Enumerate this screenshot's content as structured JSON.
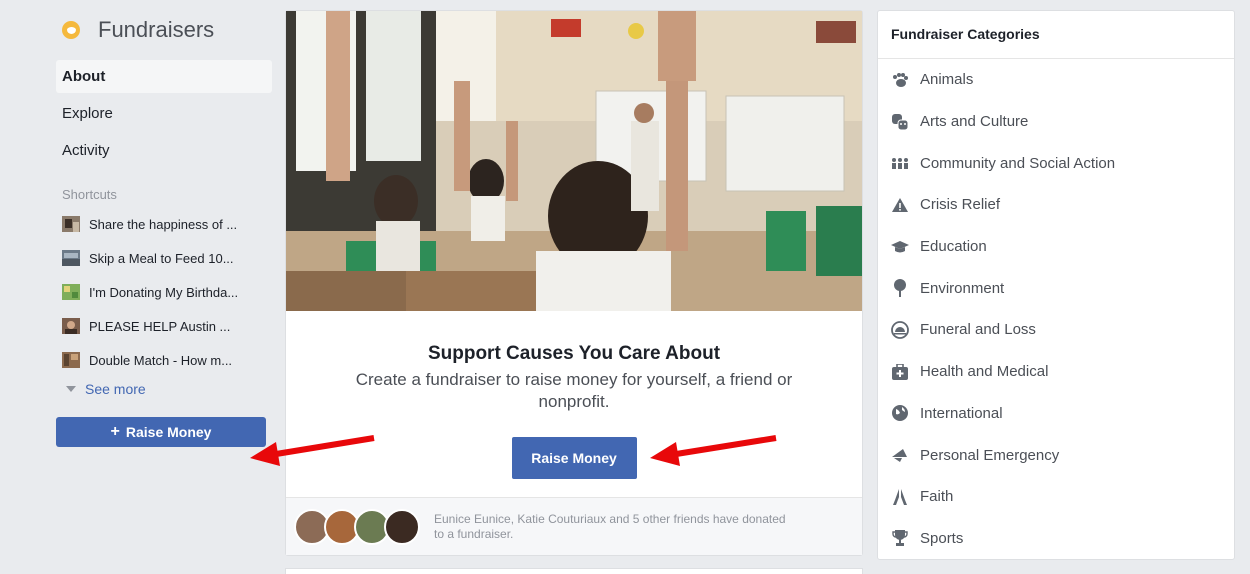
{
  "sidebar": {
    "title": "Fundraisers",
    "nav": [
      "About",
      "Explore",
      "Activity"
    ],
    "shortcuts_label": "Shortcuts",
    "shortcuts": [
      "Share the happiness of ...",
      "Skip a Meal to Feed 10...",
      "I'm Donating My Birthda...",
      "PLEASE HELP Austin ...",
      "Double Match - How m..."
    ],
    "see_more": "See more",
    "raise_button": "Raise Money"
  },
  "promo": {
    "title": "Support Causes You Care About",
    "subtitle": "Create a fundraiser to raise money for yourself, a friend or nonprofit.",
    "button": "Raise Money"
  },
  "donors": {
    "text": "Eunice Eunice, Katie Couturiaux and 5 other friends have donated to a fundraiser."
  },
  "categories": {
    "title": "Fundraiser Categories",
    "items": [
      {
        "label": "Animals",
        "icon": "paw-icon"
      },
      {
        "label": "Arts and Culture",
        "icon": "masks-icon"
      },
      {
        "label": "Community and Social Action",
        "icon": "people-icon"
      },
      {
        "label": "Crisis Relief",
        "icon": "warning-icon"
      },
      {
        "label": "Education",
        "icon": "graduation-cap-icon"
      },
      {
        "label": "Environment",
        "icon": "tree-icon"
      },
      {
        "label": "Funeral and Loss",
        "icon": "sunset-icon"
      },
      {
        "label": "Health and Medical",
        "icon": "medical-kit-icon"
      },
      {
        "label": "International",
        "icon": "globe-icon"
      },
      {
        "label": "Personal Emergency",
        "icon": "megaphone-icon"
      },
      {
        "label": "Faith",
        "icon": "praying-hands-icon"
      },
      {
        "label": "Sports",
        "icon": "trophy-icon"
      }
    ]
  },
  "colors": {
    "brand": "#4267b2",
    "background": "#e9ebee",
    "annotation_arrow": "#e8080a"
  }
}
